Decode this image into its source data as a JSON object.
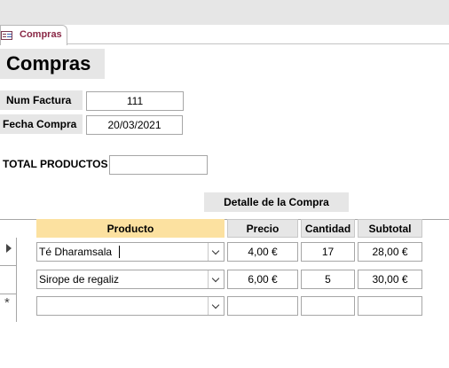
{
  "tab": {
    "label": "Compras",
    "icon": "form-icon"
  },
  "form": {
    "title": "Compras"
  },
  "fields": {
    "num_factura": {
      "label": "Num Factura",
      "value": "111"
    },
    "fecha_compra": {
      "label": "Fecha Compra",
      "value": "20/03/2021"
    },
    "total_productos": {
      "label": "TOTAL PRODUCTOS",
      "value": ""
    }
  },
  "subform": {
    "title": "Detalle de la Compra",
    "columns": [
      "Producto",
      "Precio",
      "Cantidad",
      "Subtotal"
    ],
    "rows": [
      {
        "producto": "Té Dharamsala",
        "precio": "4,00 €",
        "cantidad": "17",
        "subtotal": "28,00 €",
        "selector": "current"
      },
      {
        "producto": "Sirope de regaliz",
        "precio": "6,00 €",
        "cantidad": "5",
        "subtotal": "30,00 €",
        "selector": "none"
      },
      {
        "producto": "",
        "precio": "",
        "cantidad": "",
        "subtotal": "",
        "selector": "new"
      }
    ]
  },
  "colors": {
    "header_bg": "#e6e6e6",
    "active_column": "#fce1a0",
    "tab_text": "#8a2846"
  }
}
